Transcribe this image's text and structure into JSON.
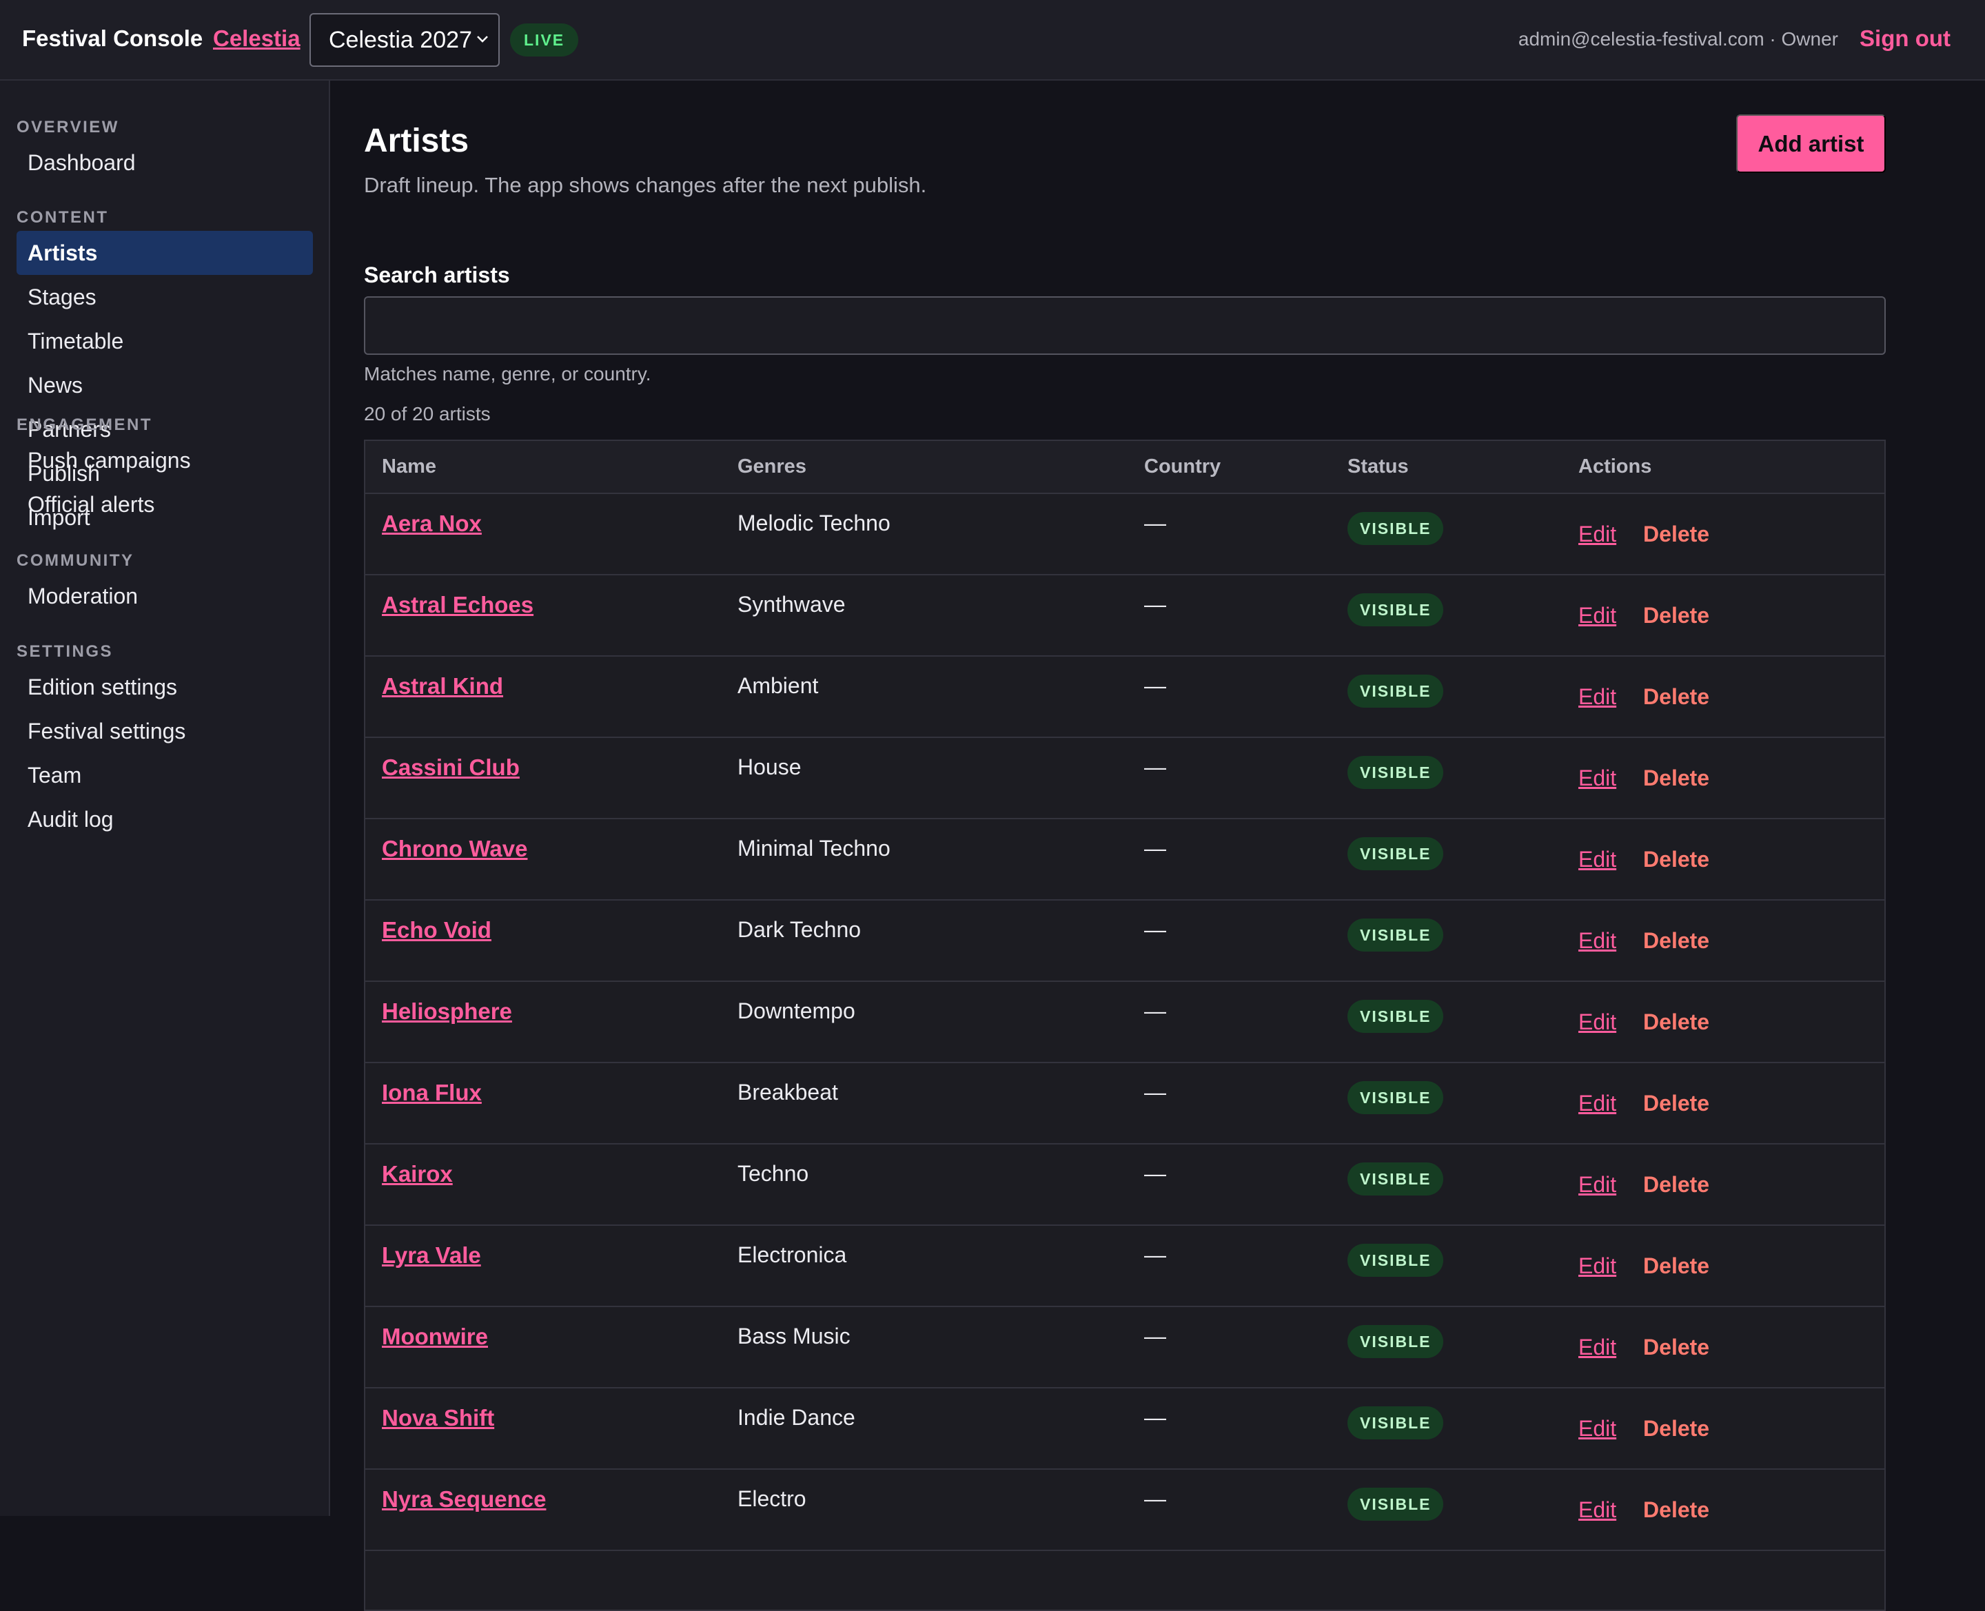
{
  "header": {
    "brand": "Festival Console",
    "festival_link": "Celestia",
    "edition_selected": "Celestia 2027",
    "live_badge": "LIVE",
    "account": "admin@celestia-festival.com · Owner",
    "sign_out": "Sign out"
  },
  "sidebar": {
    "sections": [
      {
        "title": "OVERVIEW",
        "items": [
          {
            "label": "Dashboard",
            "active": false
          }
        ]
      },
      {
        "title": "CONTENT",
        "items": [
          {
            "label": "Artists",
            "active": true
          },
          {
            "label": "Stages",
            "active": false
          },
          {
            "label": "Timetable",
            "active": false
          },
          {
            "label": "News",
            "active": false
          },
          {
            "label": "Partners",
            "active": false
          },
          {
            "label": "Publish",
            "active": false
          },
          {
            "label": "Import",
            "active": false
          }
        ]
      },
      {
        "title": "ENGAGEMENT",
        "items": [
          {
            "label": "Push campaigns",
            "active": false
          },
          {
            "label": "Official alerts",
            "active": false
          }
        ]
      },
      {
        "title": "COMMUNITY",
        "items": [
          {
            "label": "Moderation",
            "active": false
          }
        ]
      },
      {
        "title": "SETTINGS",
        "items": [
          {
            "label": "Edition settings",
            "active": false
          },
          {
            "label": "Festival settings",
            "active": false
          },
          {
            "label": "Team",
            "active": false
          },
          {
            "label": "Audit log",
            "active": false
          }
        ]
      }
    ]
  },
  "main": {
    "title": "Artists",
    "subtitle": "Draft lineup. The app shows changes after the next publish.",
    "add_button": "Add artist",
    "search_label": "Search artists",
    "search_value": "",
    "search_hint": "Matches name, genre, or country.",
    "count": "20 of 20 artists",
    "columns": [
      "Name",
      "Genres",
      "Country",
      "Status",
      "Actions"
    ],
    "edit_label": "Edit",
    "delete_label": "Delete",
    "rows": [
      {
        "name": "Aera Nox",
        "genres": "Melodic Techno",
        "country": "—",
        "status": "VISIBLE"
      },
      {
        "name": "Astral Echoes",
        "genres": "Synthwave",
        "country": "—",
        "status": "VISIBLE"
      },
      {
        "name": "Astral Kind",
        "genres": "Ambient",
        "country": "—",
        "status": "VISIBLE"
      },
      {
        "name": "Cassini Club",
        "genres": "House",
        "country": "—",
        "status": "VISIBLE"
      },
      {
        "name": "Chrono Wave",
        "genres": "Minimal Techno",
        "country": "—",
        "status": "VISIBLE"
      },
      {
        "name": "Echo Void",
        "genres": "Dark Techno",
        "country": "—",
        "status": "VISIBLE"
      },
      {
        "name": "Heliosphere",
        "genres": "Downtempo",
        "country": "—",
        "status": "VISIBLE"
      },
      {
        "name": "Iona Flux",
        "genres": "Breakbeat",
        "country": "—",
        "status": "VISIBLE"
      },
      {
        "name": "Kairox",
        "genres": "Techno",
        "country": "—",
        "status": "VISIBLE"
      },
      {
        "name": "Lyra Vale",
        "genres": "Electronica",
        "country": "—",
        "status": "VISIBLE"
      },
      {
        "name": "Moonwire",
        "genres": "Bass Music",
        "country": "—",
        "status": "VISIBLE"
      },
      {
        "name": "Nova Shift",
        "genres": "Indie Dance",
        "country": "—",
        "status": "VISIBLE"
      },
      {
        "name": "Nyra Sequence",
        "genres": "Electro",
        "country": "—",
        "status": "VISIBLE"
      }
    ]
  }
}
